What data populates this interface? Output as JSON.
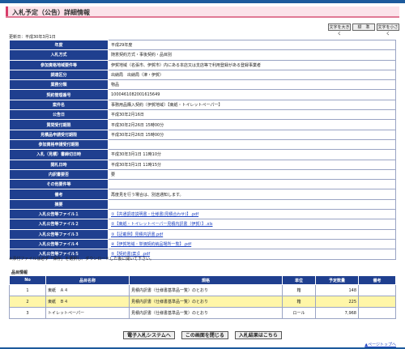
{
  "page_title": "入札予定（公告）詳細情報",
  "font_buttons": [
    "文字を大きく",
    "標　準",
    "文字を小さく"
  ],
  "updated": "更新日：平成30年3月1日",
  "detail_rows": [
    {
      "label": "年度",
      "value": "平成29年度"
    },
    {
      "label": "入札方式",
      "value": "随意契約方式・事後契約・品目別"
    },
    {
      "label": "参加資格地域要件等",
      "value": "伊賀地域（名張市、伊賀市）内にある本店又は支店等で利用登録がある登録事業者"
    },
    {
      "label": "調達区分",
      "value": "出納局　出納局（津・伊賀）"
    },
    {
      "label": "業務分類",
      "value": "物品"
    },
    {
      "label": "契約管理番号",
      "value": "1000461082001615649"
    },
    {
      "label": "案件名",
      "value": "事務用品購入契約〔伊賀地域〕【東紙・トイレットペーパー】"
    },
    {
      "label": "公告日",
      "value": "平成30年2月16日"
    },
    {
      "label": "質問受付期限",
      "value": "平成30年2月26日 15時00分"
    },
    {
      "label": "見積品申請受付期限",
      "value": "平成30年2月26日 15時00分"
    },
    {
      "label": "参加資格申請受付期限",
      "value": ""
    },
    {
      "label": "入札（見積）書締切日時",
      "value": "平成30年3月1日 11時10分"
    },
    {
      "label": "開札日時",
      "value": "平成30年3月1日 11時15分"
    },
    {
      "label": "内訳書要否",
      "value": "要"
    },
    {
      "label": "その他要件等",
      "value": ""
    },
    {
      "label": "備考",
      "value": "再度見を行う場合は、別途通知します。"
    },
    {
      "label": "摘要",
      "value": ""
    },
    {
      "label": "入札公告等ファイル１",
      "value": "①【共通調達説明書・仕様書(見積合わせ)】.pdf",
      "link": true
    },
    {
      "label": "入札公告等ファイル２",
      "value": "②【東紙・トイレットペーパー見積内訳書（伊賀）】.xls",
      "link": true
    },
    {
      "label": "入札公告等ファイル３",
      "value": "③【記載例】見積内訳書.pdf",
      "link": true
    },
    {
      "label": "入札公告等ファイル４",
      "value": "④【伊賀地域・単価契約納品場所一覧】.pdf",
      "link": true
    },
    {
      "label": "入札公告等ファイル５",
      "value": "⑤【契約書(案)】.pdf",
      "link": true
    }
  ],
  "note": "※添付ファイルは必ず「保存」を選択し、ダウンロードした後に開いて下さい。",
  "goods": {
    "label": "品目情報",
    "headers": [
      "No",
      "品目名称",
      "規格",
      "単位",
      "予定数量",
      "備考"
    ],
    "rows": [
      {
        "no": "1",
        "name": "東紙　Ａ４",
        "spec": "見積内訳書（仕様書基準品一覧）のとおり",
        "unit": "箱",
        "qty": "148",
        "note": ""
      },
      {
        "no": "2",
        "name": "東紙　Ｂ４",
        "spec": "見積内訳書（仕様書基準品一覧）のとおり",
        "unit": "箱",
        "qty": "225",
        "note": ""
      },
      {
        "no": "3",
        "name": "トイレットペーパー",
        "spec": "見積内訳書（仕様書基準品一覧）のとおり",
        "unit": "ロール",
        "qty": "7,968",
        "note": ""
      }
    ]
  },
  "bottom_buttons": [
    "電子入札システムへ",
    "この画面を閉じる",
    "入札結果はこちら"
  ],
  "page_top": "▲ページトップへ"
}
